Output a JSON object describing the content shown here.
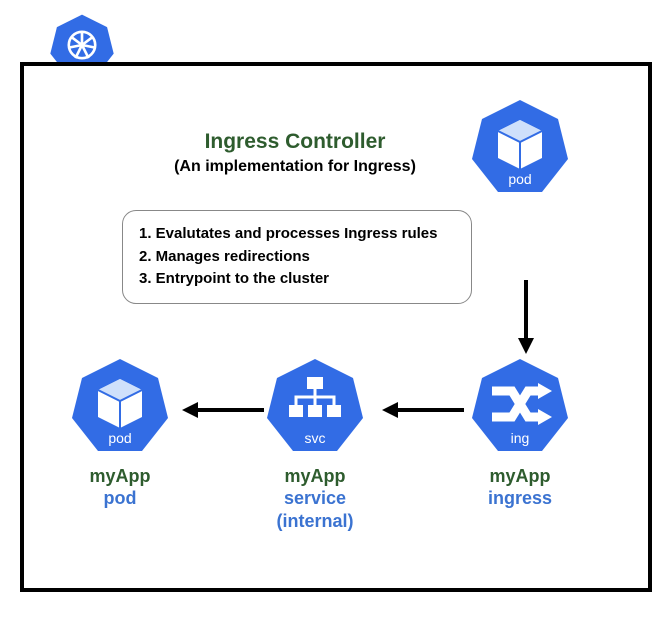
{
  "heading": {
    "title": "Ingress Controller",
    "subtitle": "(An implementation for Ingress)"
  },
  "rules": {
    "item1": "1. Evalutates and processes Ingress rules",
    "item2": "2. Manages redirections",
    "item3": "3. Entrypoint to the cluster"
  },
  "controllerPod": {
    "iconLabel": "pod"
  },
  "nodes": {
    "pod": {
      "iconLabel": "pod",
      "name": "myApp",
      "type": "pod"
    },
    "svc": {
      "iconLabel": "svc",
      "name": "myApp",
      "type": "service",
      "extra": "(internal)"
    },
    "ing": {
      "iconLabel": "ing",
      "name": "myApp",
      "type": "ingress"
    }
  },
  "colors": {
    "k8sBlue": "#326ce5",
    "brandGreen": "#2e5c2e",
    "linkBlue": "#3b73d1"
  }
}
